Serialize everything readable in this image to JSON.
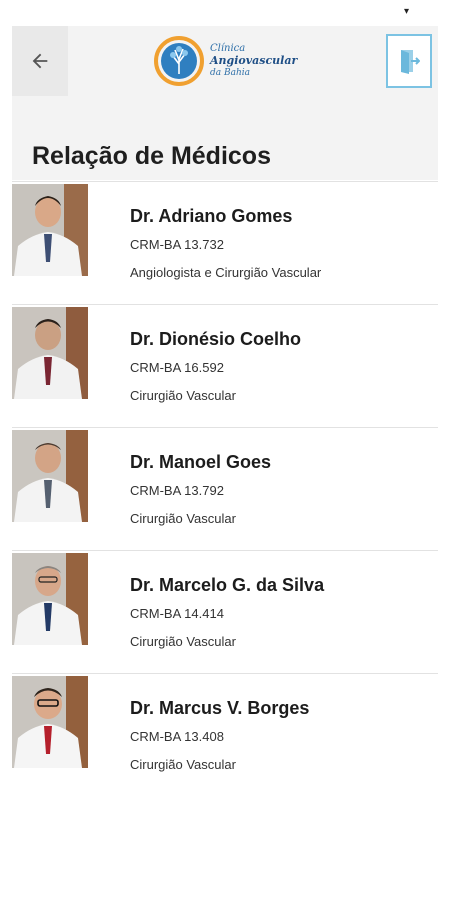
{
  "status_bar": {
    "indicator": "▾"
  },
  "app_bar": {
    "back_icon": "arrow-left-icon",
    "logo": {
      "line1": "Clínica",
      "line2": "Angiovascular",
      "line3": "da Bahia"
    },
    "exit_icon": "exit-door-icon",
    "accent_color": "#7cc3e3"
  },
  "page": {
    "title": "Relação de Médicos"
  },
  "doctors": [
    {
      "name": "Dr. Adriano Gomes",
      "crm": "CRM-BA 13.732",
      "specialty": "Angiologista e Cirurgião Vascular"
    },
    {
      "name": "Dr. Dionésio Coelho",
      "crm": "CRM-BA 16.592",
      "specialty": "Cirurgião Vascular"
    },
    {
      "name": "Dr. Manoel Goes",
      "crm": "CRM-BA 13.792",
      "specialty": "Cirurgião Vascular"
    },
    {
      "name": "Dr. Marcelo G. da Silva",
      "crm": "CRM-BA 14.414",
      "specialty": "Cirurgião Vascular"
    },
    {
      "name": "Dr. Marcus V. Borges",
      "crm": "CRM-BA 13.408",
      "specialty": "Cirurgião Vascular"
    }
  ]
}
